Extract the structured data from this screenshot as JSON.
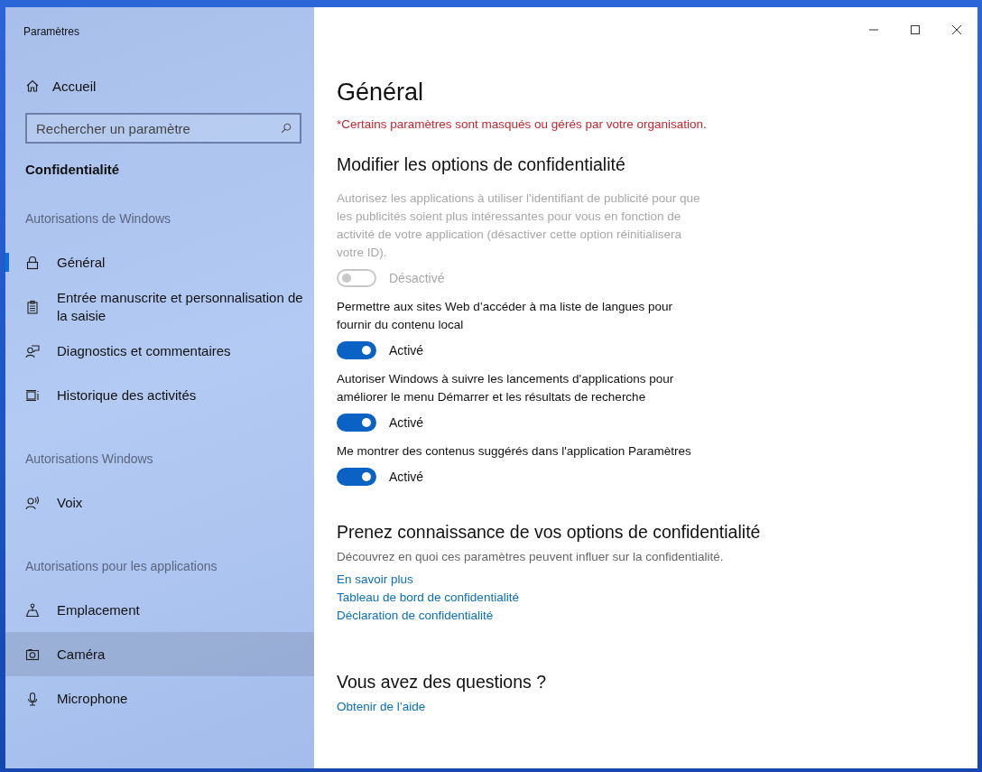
{
  "window": {
    "title": "Paramètres",
    "controls": [
      {
        "kind": "minimize"
      },
      {
        "kind": "maximize"
      },
      {
        "kind": "close"
      }
    ]
  },
  "sidebar": {
    "home": "Accueil",
    "search": {
      "placeholder": "Rechercher un paramètre"
    },
    "category": "Confidentialité",
    "sections": [
      {
        "heading": "Autorisations de Windows",
        "items": [
          {
            "label": "Général",
            "kind": "lock",
            "selected": true,
            "hovered": false
          },
          {
            "label": "Entrée manuscrite et personnalisation de la saisie",
            "kind": "clipboard",
            "selected": false,
            "hovered": false
          },
          {
            "label": "Diagnostics et commentaires",
            "kind": "feedback",
            "selected": false,
            "hovered": false
          },
          {
            "label": "Historique des activités",
            "kind": "history",
            "selected": false,
            "hovered": false
          }
        ]
      },
      {
        "heading": "Autorisations Windows",
        "items": [
          {
            "label": "Voix",
            "kind": "voice",
            "selected": false,
            "hovered": false
          }
        ]
      },
      {
        "heading": "Autorisations pour les applications",
        "items": [
          {
            "label": "Emplacement",
            "kind": "location",
            "selected": false,
            "hovered": false
          },
          {
            "label": "Caméra",
            "kind": "camera",
            "selected": false,
            "hovered": true
          },
          {
            "label": "Microphone",
            "kind": "microphone",
            "selected": false,
            "hovered": false
          }
        ]
      }
    ]
  },
  "content": {
    "title": "Général",
    "notice": "*Certains paramètres sont masqués ou gérés par votre organisation.",
    "heading": "Modifier les options de confidentialité",
    "settings": [
      {
        "description": "Autorisez les applications à utiliser l'identifiant de publicité pour que les publicités soient plus intéressantes pour vous en fonction de activité de votre application (désactiver cette option réinitialisera votre ID).",
        "on": false,
        "disabled": true,
        "state": "Désactivé"
      },
      {
        "description": "Permettre aux sites Web d’accéder à ma liste de langues pour fournir du contenu local",
        "on": true,
        "disabled": false,
        "state": "Activé"
      },
      {
        "description": "Autoriser Windows à suivre les lancements d'applications pour améliorer le menu Démarrer et les résultats de recherche",
        "on": true,
        "disabled": false,
        "state": "Activé"
      },
      {
        "description": "Me montrer des contenus suggérés dans l'application Paramètres",
        "on": true,
        "disabled": false,
        "state": "Activé"
      }
    ],
    "privacy": {
      "heading": "Prenez connaissance de vos options de confidentialité",
      "text": "Découvrez en quoi ces paramètres peuvent influer sur la confidentialité.",
      "links": [
        "En savoir plus",
        "Tableau de bord de confidentialité",
        "Déclaration de confidentialité"
      ]
    },
    "questions": {
      "heading": "Vous avez des questions ?",
      "links": [
        "Obtenir de l’aide"
      ]
    }
  }
}
